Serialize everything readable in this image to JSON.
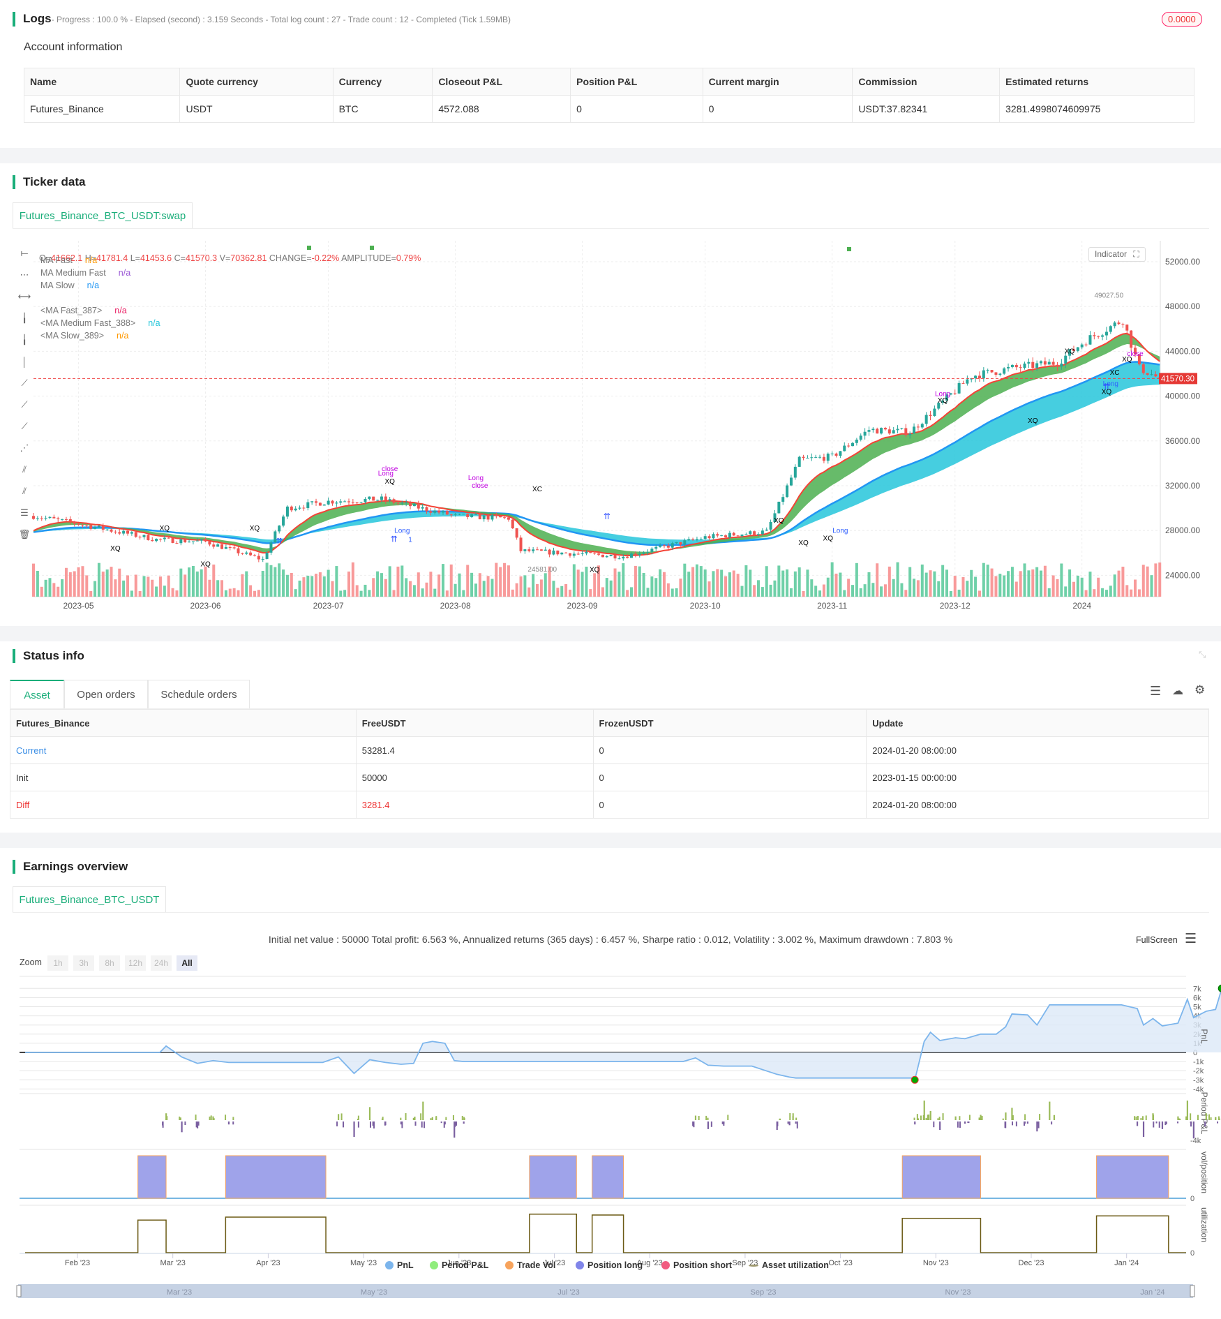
{
  "logs": {
    "title": "Logs",
    "subtitle": "- Progress : 100.0 % - Elapsed (second) : 3.159  Seconds - Total log count : 27 - Trade count : 12 - Completed (Tick 1.59MB)",
    "badge": "0.0000"
  },
  "account": {
    "title": "Account information",
    "headers": [
      "Name",
      "Quote currency",
      "Currency",
      "Closeout P&L",
      "Position P&L",
      "Current margin",
      "Commission",
      "Estimated returns"
    ],
    "row": [
      "Futures_Binance",
      "USDT",
      "BTC",
      "4572.088",
      "0",
      "0",
      "USDT:37.82341",
      "3281.4998074609975"
    ]
  },
  "ticker": {
    "title": "Ticker data",
    "tab": "Futures_Binance_BTC_USDT:swap",
    "ohlc": {
      "o_label": "O=",
      "o": "41662.1",
      "h_label": " H=",
      "h": "41781.4",
      "l_label": " L=",
      "l": "41453.6",
      "c_label": " C=",
      "c": "41570.3",
      "v_label": " V=",
      "v": "70362.81",
      "change_label": " CHANGE=",
      "change": "-0.22%",
      "amp_label": " AMPLITUDE=",
      "amp": "0.79%"
    },
    "legend": [
      {
        "name": "MA Fast",
        "value": "n/a",
        "color": "#ff9800"
      },
      {
        "name": "MA Medium Fast",
        "value": "n/a",
        "color": "#9c5bd6"
      },
      {
        "name": "MA Slow",
        "value": "n/a",
        "color": "#2196f3"
      },
      {
        "name": "<MA Fast_387>",
        "value": "n/a",
        "color": "#e91e63"
      },
      {
        "name": "<MA Medium Fast_388>",
        "value": "n/a",
        "color": "#26c6da"
      },
      {
        "name": "<MA Slow_389>",
        "value": "n/a",
        "color": "#ff9800"
      }
    ],
    "indicator_label": "Indicator",
    "price_ticks": [
      "52000.00",
      "48000.00",
      "44000.00",
      "40000.00",
      "36000.00",
      "32000.00",
      "28000.00",
      "24000.00"
    ],
    "price_tick_values": [
      52000,
      48000,
      44000,
      40000,
      36000,
      32000,
      28000,
      24000
    ],
    "date_ticks": [
      "2023-05",
      "2023-06",
      "2023-07",
      "2023-08",
      "2023-09",
      "2023-10",
      "2023-11",
      "2023-12",
      "2024"
    ],
    "date_tick_days": [
      11,
      42,
      72,
      103,
      134,
      164,
      195,
      225,
      256
    ],
    "last_price": "41570.30",
    "last_price_value": 41570.3,
    "high_label": "49027.50",
    "high_value": 49027.5,
    "high_day": 258,
    "low_label": "24581.00",
    "low_value": 24581,
    "low_day": 120,
    "price_waypoints": [
      [
        0,
        29300
      ],
      [
        11,
        28600
      ],
      [
        30,
        27200
      ],
      [
        42,
        27000
      ],
      [
        56,
        25400
      ],
      [
        62,
        30000
      ],
      [
        72,
        30600
      ],
      [
        85,
        30800
      ],
      [
        103,
        29300
      ],
      [
        116,
        29100
      ],
      [
        119,
        26200
      ],
      [
        134,
        25900
      ],
      [
        144,
        25700
      ],
      [
        164,
        27400
      ],
      [
        179,
        27900
      ],
      [
        187,
        34300
      ],
      [
        195,
        34600
      ],
      [
        204,
        37000
      ],
      [
        214,
        36800
      ],
      [
        229,
        41800
      ],
      [
        239,
        42500
      ],
      [
        250,
        43000
      ],
      [
        257,
        45000
      ],
      [
        266,
        46800
      ],
      [
        270,
        42500
      ],
      [
        275,
        41570
      ]
    ],
    "markers": [
      {
        "day": 87,
        "price": 33300,
        "text": "close",
        "color": "#c000e0"
      },
      {
        "day": 86,
        "price": 32900,
        "text": "Long",
        "color": "#c000e0"
      },
      {
        "day": 87,
        "price": 32200,
        "text": "XQ",
        "color": "#000"
      },
      {
        "day": 108,
        "price": 32500,
        "text": "Long",
        "color": "#c000e0"
      },
      {
        "day": 109,
        "price": 31800,
        "text": "close",
        "color": "#c000e0"
      },
      {
        "day": 32,
        "price": 28000,
        "text": "XQ",
        "color": "#000"
      },
      {
        "day": 20,
        "price": 26200,
        "text": "XQ",
        "color": "#000"
      },
      {
        "day": 42,
        "price": 24800,
        "text": "XQ",
        "color": "#000"
      },
      {
        "day": 54,
        "price": 28000,
        "text": "XQ",
        "color": "#000"
      },
      {
        "day": 90,
        "price": 27800,
        "text": "Long",
        "color": "#3060ff"
      },
      {
        "day": 92,
        "price": 27000,
        "text": "1",
        "color": "#3060ff"
      },
      {
        "day": 123,
        "price": 31500,
        "text": "XC",
        "color": "#000"
      },
      {
        "day": 137,
        "price": 24300,
        "text": "XQ",
        "color": "#000"
      },
      {
        "day": 182,
        "price": 28700,
        "text": "XQ",
        "color": "#000"
      },
      {
        "day": 188,
        "price": 26700,
        "text": "XQ",
        "color": "#000"
      },
      {
        "day": 194,
        "price": 27100,
        "text": "XQ",
        "color": "#000"
      },
      {
        "day": 197,
        "price": 27800,
        "text": "Long",
        "color": "#3060ff"
      },
      {
        "day": 222,
        "price": 40000,
        "text": "Long",
        "color": "#c000e0"
      },
      {
        "day": 222,
        "price": 39400,
        "text": "XQ",
        "color": "#000"
      },
      {
        "day": 244,
        "price": 37600,
        "text": "XQ",
        "color": "#000"
      },
      {
        "day": 253,
        "price": 43800,
        "text": "XQ",
        "color": "#000"
      },
      {
        "day": 263,
        "price": 40900,
        "text": "Long",
        "color": "#3060ff"
      },
      {
        "day": 262,
        "price": 40200,
        "text": "XQ",
        "color": "#000"
      },
      {
        "day": 284,
        "price": 41900,
        "text": "XC",
        "color": "#000"
      },
      {
        "day": 287,
        "price": 43100,
        "text": "XQ",
        "color": "#000"
      },
      {
        "day": 289,
        "price": 43600,
        "text": "close",
        "color": "#c000e0"
      }
    ]
  },
  "status": {
    "title": "Status info",
    "tabs": [
      "Asset",
      "Open orders",
      "Schedule orders"
    ],
    "headers": [
      "Futures_Binance",
      "FreeUSDT",
      "FrozenUSDT",
      "Update"
    ],
    "rows": [
      [
        "Current",
        "53281.4",
        "0",
        "2024-01-20 08:00:00"
      ],
      [
        "Init",
        "50000",
        "0",
        "2023-01-15 00:00:00"
      ],
      [
        "Diff",
        "3281.4",
        "0",
        "2024-01-20 08:00:00"
      ]
    ]
  },
  "earnings": {
    "title": "Earnings overview",
    "tab": "Futures_Binance_BTC_USDT",
    "summary": "Initial net value : 50000 Total profit: 6.563 %, Annualized returns (365 days) : 6.457 %, Sharpe ratio : 0.012, Volatility : 3.002 %, Maximum drawdown : 7.803 %",
    "fullscreen": "FullScreen",
    "zoom_label": "Zoom",
    "zoom_buttons": [
      "1h",
      "3h",
      "8h",
      "12h",
      "24h",
      "All"
    ],
    "pnl_ticks": [
      "7k",
      "6k",
      "5k",
      "4k",
      "3k",
      "2k",
      "1k",
      "0",
      "-1k",
      "-2k",
      "-3k",
      "-4k"
    ],
    "pnl_tick_values": [
      7000,
      6000,
      5000,
      4000,
      3000,
      2000,
      1000,
      0,
      -1000,
      -2000,
      -3000,
      -4000
    ],
    "axis_titles": [
      "PnL",
      "Period P&L",
      "vol/position",
      "utilization"
    ],
    "period_tick": "-4k",
    "zero": "0",
    "months": [
      "Feb '23",
      "Mar '23",
      "Apr '23",
      "May '23",
      "Jun '23",
      "Jul '23",
      "Aug '23",
      "Sep '23",
      "Oct '23",
      "Nov '23",
      "Dec '23",
      "Jan '24"
    ],
    "navigator_months": [
      "Mar '23",
      "May '23",
      "Jul '23",
      "Sep '23",
      "Nov '23",
      "Jan '24"
    ],
    "legend": [
      {
        "label": "PnL",
        "color": "#7cb5ec"
      },
      {
        "label": "Period P&L",
        "color": "#90ed7d"
      },
      {
        "label": "Trade Vol",
        "color": "#f7a35c"
      },
      {
        "label": "Position long",
        "color": "#8085e9"
      },
      {
        "label": "Position short",
        "color": "#f15c80"
      },
      {
        "label": "Asset utilization",
        "color": "#a09a70"
      }
    ],
    "pnl_series": [
      [
        0,
        0
      ],
      [
        43,
        0
      ],
      [
        45,
        700
      ],
      [
        50,
        -500
      ],
      [
        55,
        -1200
      ],
      [
        60,
        -900
      ],
      [
        65,
        -1100
      ],
      [
        95,
        -1100
      ],
      [
        100,
        -500
      ],
      [
        105,
        -2300
      ],
      [
        110,
        -800
      ],
      [
        115,
        -1100
      ],
      [
        120,
        -1300
      ],
      [
        124,
        -1200
      ],
      [
        127,
        1000
      ],
      [
        130,
        1200
      ],
      [
        134,
        1000
      ],
      [
        137,
        -900
      ],
      [
        140,
        -1000
      ],
      [
        210,
        -1000
      ],
      [
        214,
        -600
      ],
      [
        218,
        -1400
      ],
      [
        223,
        -1500
      ],
      [
        232,
        -1500
      ],
      [
        240,
        -2400
      ],
      [
        244,
        -2700
      ],
      [
        246,
        -2800
      ],
      [
        283,
        -2800
      ],
      [
        284,
        -3000
      ],
      [
        287,
        1200
      ],
      [
        289,
        2200
      ],
      [
        292,
        1300
      ],
      [
        297,
        1600
      ],
      [
        300,
        1500
      ],
      [
        305,
        2000
      ],
      [
        310,
        2000
      ],
      [
        313,
        2800
      ],
      [
        315,
        4200
      ],
      [
        320,
        4100
      ],
      [
        323,
        3000
      ],
      [
        327,
        5200
      ],
      [
        350,
        5200
      ],
      [
        355,
        4800
      ],
      [
        357,
        3000
      ],
      [
        360,
        3700
      ],
      [
        363,
        2900
      ],
      [
        368,
        3200
      ],
      [
        371,
        5800
      ],
      [
        373,
        3800
      ],
      [
        377,
        4500
      ],
      [
        380,
        4700
      ],
      [
        382,
        7000
      ],
      [
        384,
        5800
      ],
      [
        386,
        6700
      ],
      [
        390,
        3500
      ],
      [
        392,
        3200
      ],
      [
        400,
        3200
      ]
    ],
    "positions": [
      [
        36,
        45
      ],
      [
        64,
        96
      ],
      [
        161,
        176
      ],
      [
        181,
        191
      ],
      [
        280,
        305
      ],
      [
        342,
        365
      ]
    ],
    "utilization": [
      0.78,
      0.85,
      0.92,
      0.9,
      0.82,
      0.88
    ]
  }
}
